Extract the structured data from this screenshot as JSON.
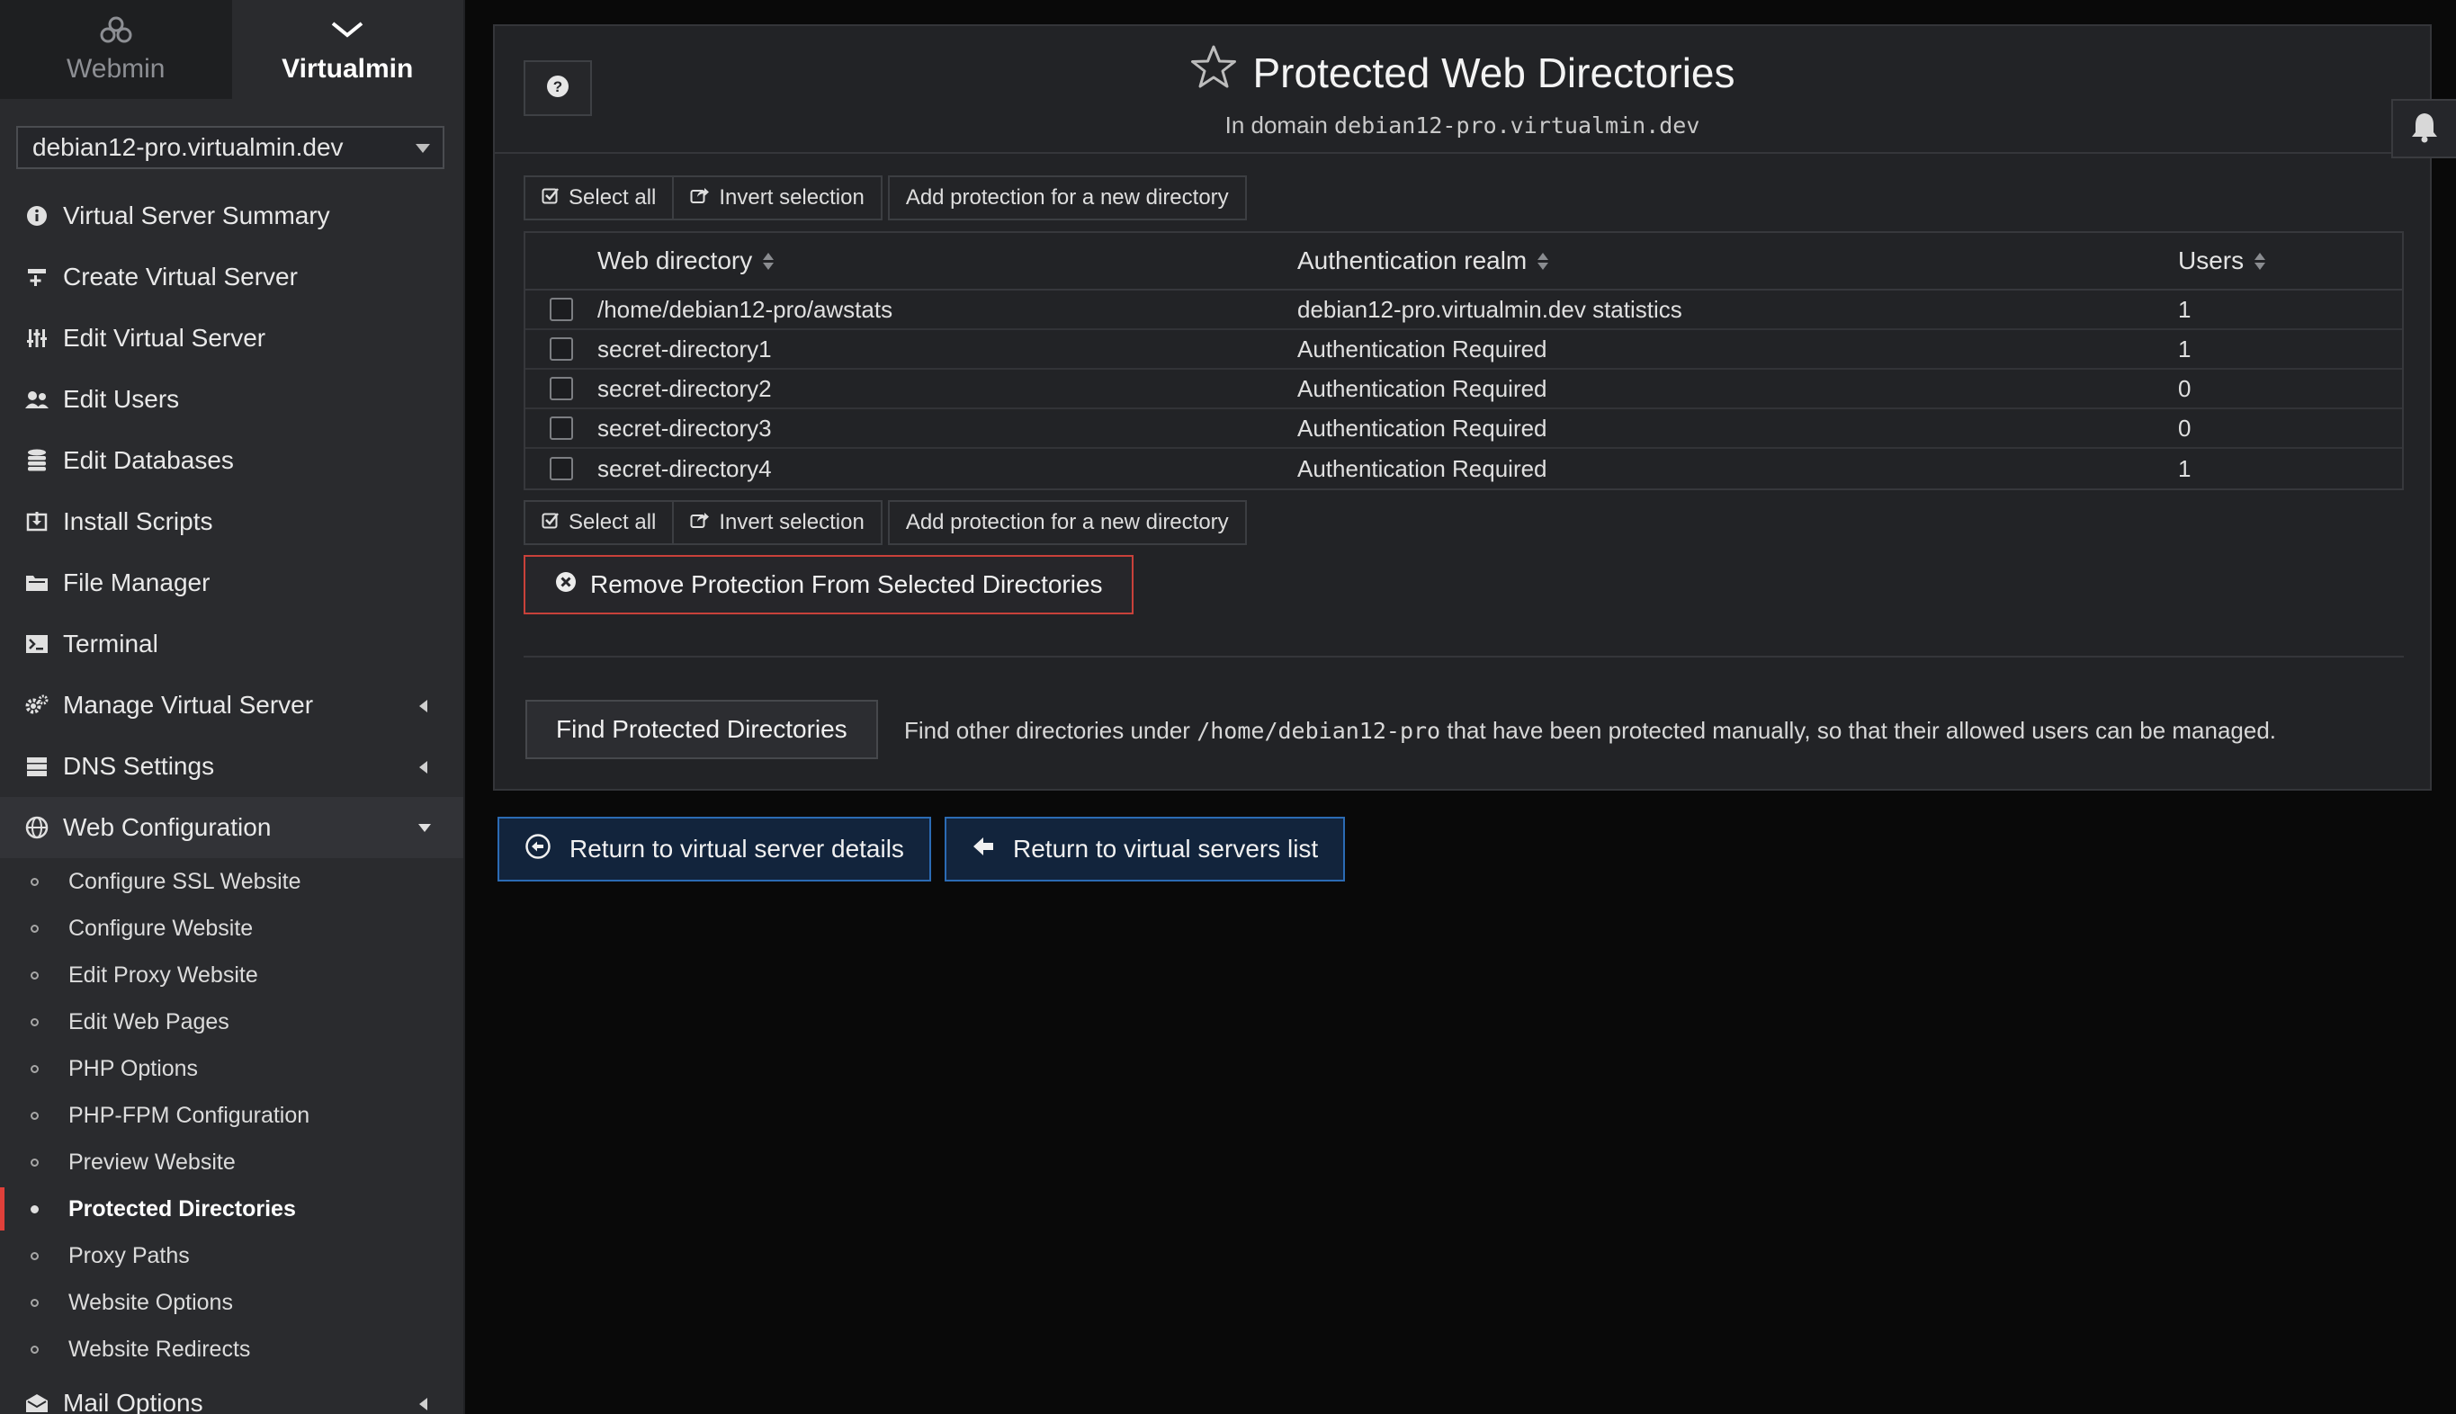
{
  "switcher": {
    "webmin": "Webmin",
    "virtualmin": "Virtualmin"
  },
  "domain_select": {
    "value": "debian12-pro.virtualmin.dev"
  },
  "menu": [
    {
      "label": "Virtual Server Summary",
      "icon": "info-icon"
    },
    {
      "label": "Create Virtual Server",
      "icon": "plus-server-icon"
    },
    {
      "label": "Edit Virtual Server",
      "icon": "sliders-icon"
    },
    {
      "label": "Edit Users",
      "icon": "users-icon"
    },
    {
      "label": "Edit Databases",
      "icon": "database-icon"
    },
    {
      "label": "Install Scripts",
      "icon": "install-icon"
    },
    {
      "label": "File Manager",
      "icon": "folder-icon"
    },
    {
      "label": "Terminal",
      "icon": "terminal-icon"
    },
    {
      "label": "Manage Virtual Server",
      "icon": "gears-icon"
    },
    {
      "label": "DNS Settings",
      "icon": "server-icon"
    },
    {
      "label": "Web Configuration",
      "icon": "globe-icon"
    },
    {
      "label": "Mail Options",
      "icon": "envelope-icon"
    }
  ],
  "web_config_items": [
    "Configure SSL Website",
    "Configure Website",
    "Edit Proxy Website",
    "Edit Web Pages",
    "PHP Options",
    "PHP-FPM Configuration",
    "Preview Website",
    "Protected Directories",
    "Proxy Paths",
    "Website Options",
    "Website Redirects"
  ],
  "page": {
    "title": "Protected Web Directories",
    "subtitle_prefix": "In domain",
    "subtitle_domain": "debian12-pro.virtualmin.dev"
  },
  "actions": {
    "select_all": "Select all",
    "invert": "Invert selection",
    "add": "Add protection for a new directory"
  },
  "table": {
    "headers": {
      "dir": "Web directory",
      "realm": "Authentication realm",
      "users": "Users"
    },
    "rows": [
      {
        "dir": "/home/debian12-pro/awstats",
        "realm": "debian12-pro.virtualmin.dev statistics",
        "users": "1"
      },
      {
        "dir": "secret-directory1",
        "realm": "Authentication Required",
        "users": "1"
      },
      {
        "dir": "secret-directory2",
        "realm": "Authentication Required",
        "users": "0"
      },
      {
        "dir": "secret-directory3",
        "realm": "Authentication Required",
        "users": "0"
      },
      {
        "dir": "secret-directory4",
        "realm": "Authentication Required",
        "users": "1"
      }
    ]
  },
  "remove_button": "Remove Protection From Selected Directories",
  "find": {
    "button": "Find Protected Directories",
    "desc_prefix": "Find other directories under",
    "desc_path": "/home/debian12-pro",
    "desc_suffix": "that have been protected manually, so that their allowed users can be managed."
  },
  "nav": {
    "return_details": "Return to virtual server details",
    "return_list": "Return to virtual servers list"
  },
  "colors": {
    "accent_red": "#e0403a",
    "nav_border": "#2b6bb4",
    "remove_border": "#c8413a"
  }
}
